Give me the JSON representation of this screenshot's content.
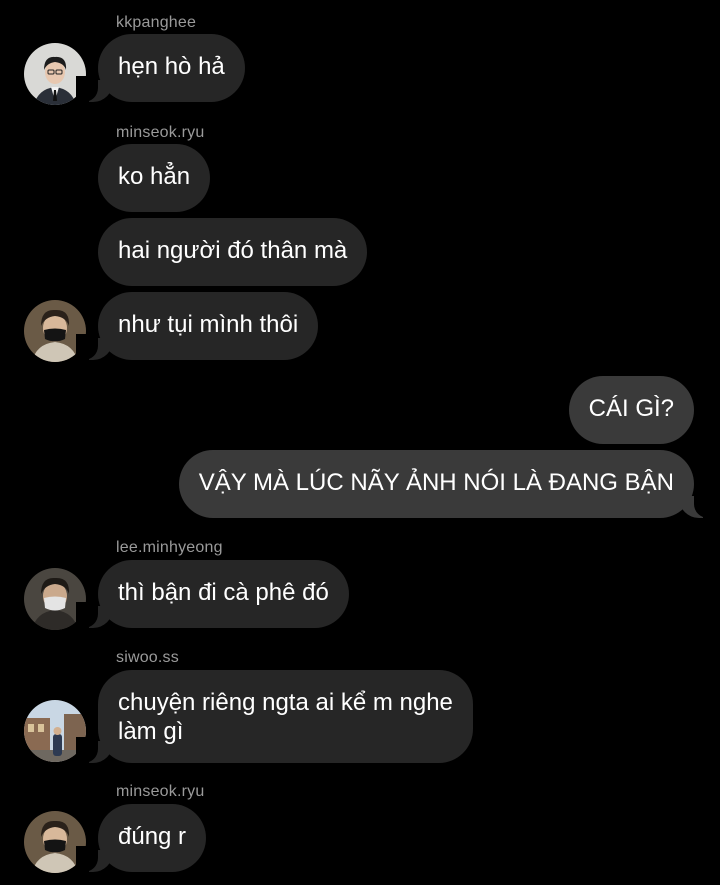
{
  "messages": [
    {
      "sender": "kkpanghee",
      "text": "hẹn hò hả"
    },
    {
      "sender": "minseok.ryu",
      "text": "ko hẳn"
    },
    {
      "text": "hai người đó thân mà"
    },
    {
      "text": "như tụi mình thôi"
    },
    {
      "sender": "me",
      "text": "CÁI GÌ?"
    },
    {
      "sender": "me",
      "text": "VẬY MÀ LÚC NÃY ẢNH NÓI LÀ ĐANG BẬN"
    },
    {
      "sender": "lee.minhyeong",
      "text": "thì bận đi cà phê đó"
    },
    {
      "sender": "siwoo.ss",
      "lines": [
        "chuyện riêng ngta ai kể m nghe",
        "làm gì"
      ]
    },
    {
      "sender": "minseok.ryu",
      "text": "đúng r"
    }
  ],
  "avatars": {
    "kkpanghee": "portrait-suit-glasses",
    "minseok.ryu": "portrait-black-mask",
    "lee.minhyeong": "portrait-white-mask",
    "siwoo.ss": "portrait-street-scene"
  },
  "colors": {
    "background": "#000000",
    "incoming_bubble": "#262626",
    "outgoing_bubble": "#3a3a3a",
    "username": "#9a9a9a",
    "text": "#ffffff"
  }
}
